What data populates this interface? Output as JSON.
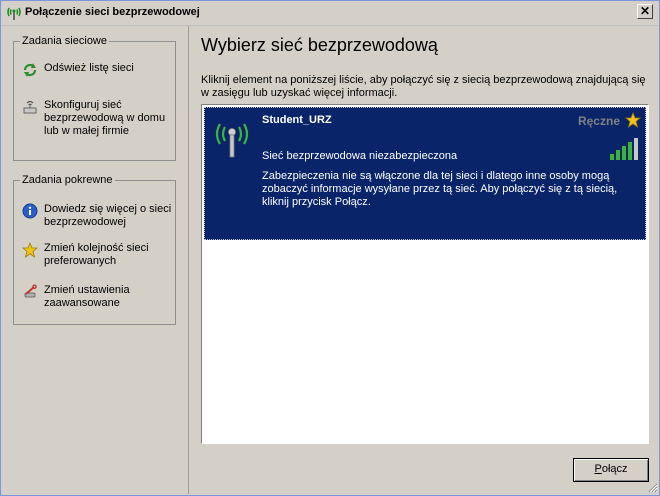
{
  "window": {
    "title": "Połączenie sieci bezprzewodowej",
    "close_symbol": "✕"
  },
  "sidebar": {
    "network_tasks": {
      "title": "Zadania sieciowe",
      "items": [
        {
          "label": "Odśwież listę sieci",
          "icon": "refresh-icon"
        },
        {
          "label": "Skonfiguruj sieć bezprzewodową w domu lub w małej firmie",
          "icon": "wireless-setup-icon"
        }
      ]
    },
    "related_tasks": {
      "title": "Zadania pokrewne",
      "items": [
        {
          "label": "Dowiedz się więcej o sieci bezprzewodowej",
          "icon": "info-icon"
        },
        {
          "label": "Zmień kolejność sieci preferowanych",
          "icon": "star-icon"
        },
        {
          "label": "Zmień ustawienia zaawansowane",
          "icon": "settings-wrench-icon"
        }
      ]
    }
  },
  "main": {
    "heading": "Wybierz sieć bezprzewodową",
    "instructions": "Kliknij element na poniższej liście, aby połączyć się z siecią bezprzewodową znajdującą się w zasięgu lub uzyskać więcej informacji.",
    "networks": [
      {
        "name": "Student_URZ",
        "mode": "Ręczne",
        "security": "Sieć bezprzewodowa niezabezpieczona",
        "description": "Zabezpieczenia nie są włączone dla tej sieci i dlatego inne osoby mogą zobaczyć informacje wysyłane przez tą sieć. Aby połączyć się z tą siecią, kliknij przycisk Połącz.",
        "signal_bars_lit": 4,
        "signal_bars_total": 5,
        "selected": true
      }
    ],
    "connect_button": {
      "accel": "P",
      "rest": "ołącz"
    }
  },
  "colors": {
    "selection": "#0a246a",
    "signal": "#3cb43c",
    "dialog_bg": "#d4d0c8"
  }
}
